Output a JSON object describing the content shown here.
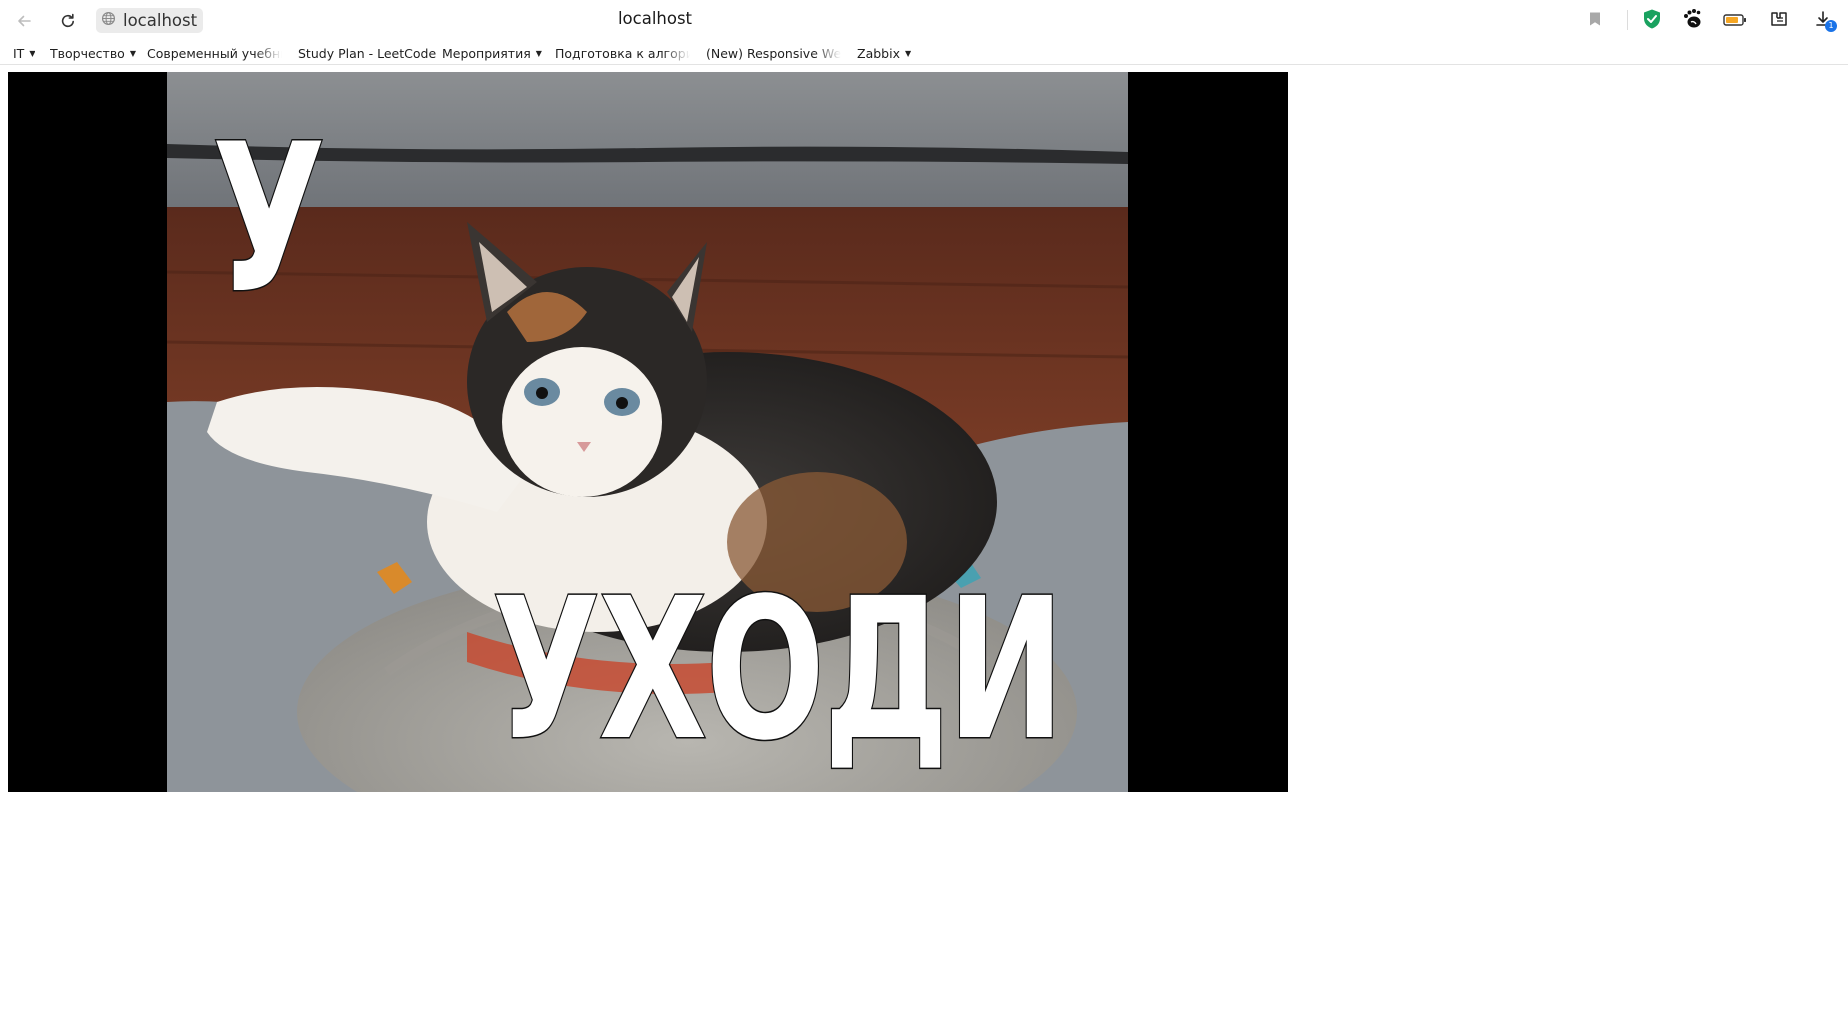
{
  "window": {
    "title": "localhost",
    "url": "localhost"
  },
  "toolbar": {
    "icons": [
      "back-arrow-icon",
      "reload-icon",
      "globe-icon",
      "bookmark-icon",
      "shield-check-icon",
      "gnome-foot-icon",
      "battery-icon",
      "extension-icon",
      "download-icon"
    ],
    "download_badge": "1",
    "accent": "#1a73e8",
    "shield_color": "#1aa260",
    "battery_color": "#f5a623"
  },
  "bookmarks": {
    "items": [
      {
        "label": "IT",
        "folder": true
      },
      {
        "label": "Творчество",
        "folder": true
      },
      {
        "label": "Современный учебник",
        "folder": false
      },
      {
        "label": "Study Plan - LeetCode",
        "folder": false
      },
      {
        "label": "Мероприятия",
        "folder": true
      },
      {
        "label": "Подготовка к алгоритмам",
        "folder": false
      },
      {
        "label": "(New) Responsive Web",
        "folder": false
      },
      {
        "label": "Zabbix",
        "folder": true
      }
    ]
  },
  "content": {
    "image_subject": "kitten meme",
    "caption_top": "У",
    "caption_bottom": "УХОДИ"
  }
}
